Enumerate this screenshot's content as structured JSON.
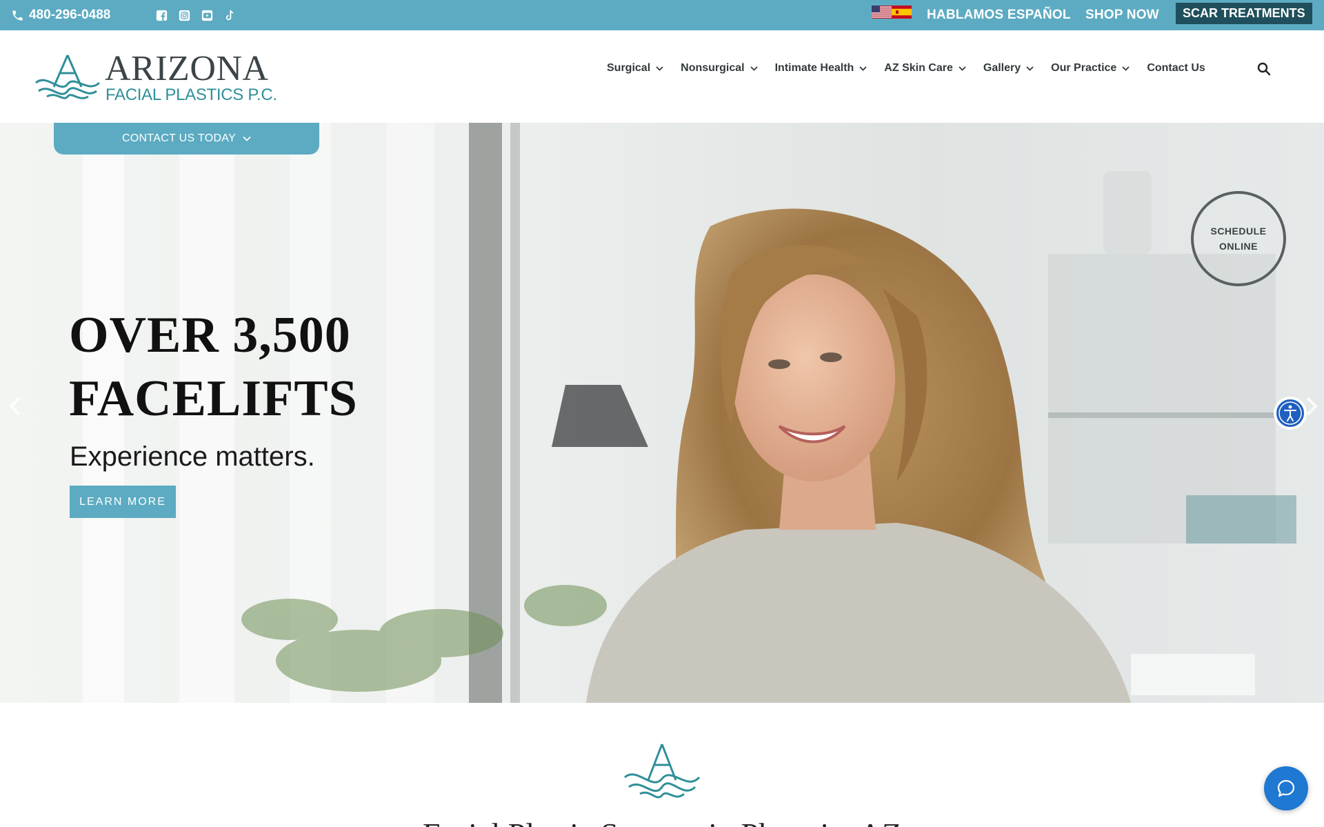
{
  "topbar": {
    "phone": "480-296-0488",
    "social_icons": [
      "facebook-icon",
      "instagram-icon",
      "youtube-icon",
      "tiktok-icon"
    ],
    "flags": [
      "us-flag-icon",
      "spain-flag-icon"
    ],
    "espanol": "HABLAMOS ESPAÑOL",
    "shop": "SHOP NOW",
    "scar": "SCAR TREATMENTS",
    "colors": {
      "bar": "#5cabc2",
      "scar_bg": "#1f4f5c"
    }
  },
  "logo": {
    "word": "ARIZONA",
    "sub": "FACIAL PLASTICS P.C.",
    "colors": {
      "mark": "#2f8f98",
      "word": "#3c4448"
    }
  },
  "nav": {
    "items": [
      {
        "label": "Surgical",
        "has_dropdown": true
      },
      {
        "label": "Nonsurgical",
        "has_dropdown": true
      },
      {
        "label": "Intimate Health",
        "has_dropdown": true
      },
      {
        "label": "AZ Skin Care",
        "has_dropdown": true
      },
      {
        "label": "Gallery",
        "has_dropdown": true
      },
      {
        "label": "Our Practice",
        "has_dropdown": true
      },
      {
        "label": "Contact Us",
        "has_dropdown": false
      }
    ],
    "search_icon": "search-icon"
  },
  "contact_tab": {
    "label": "CONTACT US TODAY"
  },
  "hero": {
    "title_line1": "OVER 3,500",
    "title_line2": "FACELIFTS",
    "subtitle": "Experience matters.",
    "cta": "LEARN MORE",
    "schedule_line1": "SCHEDULE",
    "schedule_line2": "ONLINE",
    "slide_count": 7,
    "active_slide": 1,
    "accent": "#5cabc2"
  },
  "below": {
    "title": "Facial Plastic Surgery in Phoenix, AZ"
  },
  "widgets": {
    "accessibility_icon": "accessibility-icon",
    "chat_icon": "chat-icon",
    "chat_color": "#1f78d1"
  }
}
